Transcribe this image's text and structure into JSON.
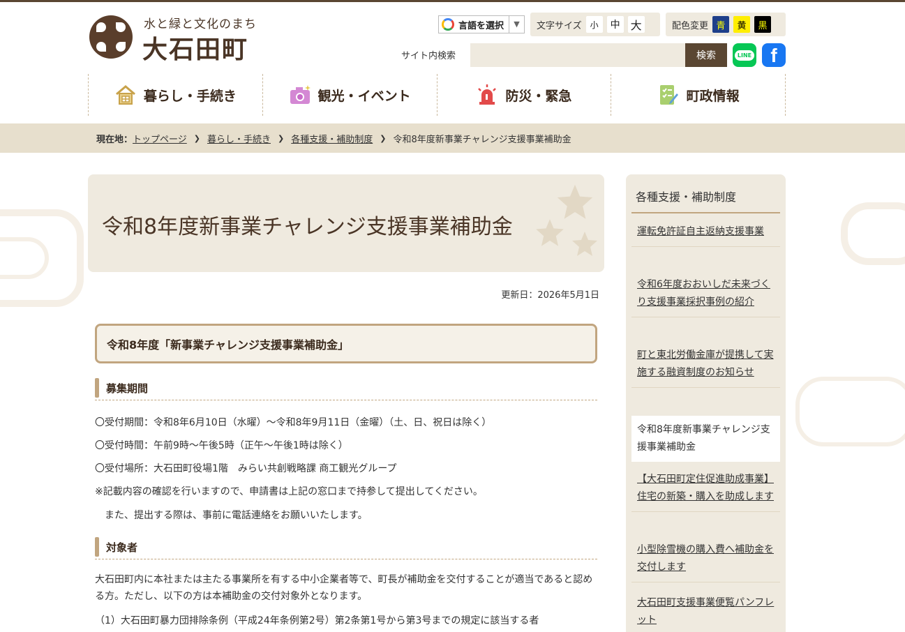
{
  "header": {
    "tagline": "水と緑と文化のまち",
    "town_name": "大石田町",
    "language_button": "言語を選択",
    "language_arrow": "▼",
    "font_size_label": "文字サイズ",
    "font_sizes": [
      "小",
      "中",
      "大"
    ],
    "color_label": "配色変更",
    "colors": [
      {
        "label": "青",
        "bg": "#1e3f8a",
        "fg": "#ffff00"
      },
      {
        "label": "黄",
        "bg": "#ffee00",
        "fg": "#000000"
      },
      {
        "label": "黒",
        "bg": "#000000",
        "fg": "#ffff00"
      }
    ],
    "search_label": "サイト内検索",
    "search_placeholder": "",
    "search_button": "検索",
    "line_label": "LINE",
    "facebook_label": "f"
  },
  "nav": [
    {
      "label": "暮らし・手続き",
      "icon": "house-icon",
      "color": "#c8a24a"
    },
    {
      "label": "観光・イベント",
      "icon": "camera-icon",
      "color": "#c86bc8"
    },
    {
      "label": "防災・緊急",
      "icon": "siren-icon",
      "color": "#d83a3a"
    },
    {
      "label": "町政情報",
      "icon": "checklist-icon",
      "color": "#8ab84a"
    }
  ],
  "breadcrumb": {
    "label": "現在地：",
    "items": [
      "トップページ",
      "暮らし・手続き",
      "各種支援・補助制度"
    ],
    "current": "令和8年度新事業チャレンジ支援事業補助金",
    "separator": "❯"
  },
  "main": {
    "title": "令和8年度新事業チャレンジ支援事業補助金",
    "updated": "更新日：2026年5月1日",
    "section_title": "令和8年度「新事業チャレンジ支援事業補助金」",
    "recruit_heading": "募集期間",
    "recruit_lines": [
      "〇受付期間：令和8年6月10日（水曜）～令和8年9月11日（金曜）（土、日、祝日は除く）",
      "〇受付時間：午前9時～午後5時（正午～午後1時は除く）",
      "〇受付場所：大石田町役場1階　みらい共創戦略課 商工観光グループ",
      "※記載内容の確認を行いますので、申請書は上記の窓口まで持参して提出してください。",
      "　また、提出する際は、事前に電話連絡をお願いいたします。"
    ],
    "target_heading": "対象者",
    "target_text": "大石田町内に本社または主たる事業所を有する中小企業者等で、町長が補助金を交付することが適当であると認める方。ただし、以下の方は本補助金の交付対象外となります。",
    "target_item1": "（1）大石田町暴力団排除条例（平成24年条例第2号）第2条第1号から第3号までの規定に該当する者"
  },
  "sidebar": {
    "heading": "各種支援・補助制度",
    "items": [
      "運転免許証自主返納支援事業",
      "令和6年度おおいしだ未来づくり支援事業採択事例の紹介",
      "町と東北労働金庫が提携して実施する融資制度のお知らせ",
      "令和8年度新事業チャレンジ支援事業補助金",
      "【大石田町定住促進助成事業】住宅の新築・購入を助成します",
      "小型除雪機の購入費へ補助金を交付します",
      "大石田町支援事業便覧パンフレット"
    ]
  }
}
